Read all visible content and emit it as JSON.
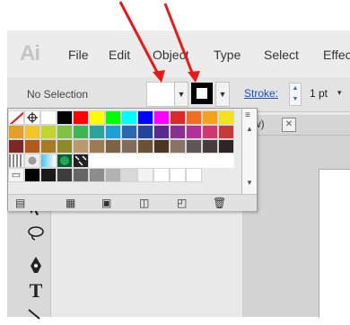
{
  "app": {
    "logo": "Ai",
    "accent": "#e31b1b"
  },
  "menu": {
    "items": [
      "File",
      "Edit",
      "Object",
      "Type",
      "Select",
      "Effect"
    ]
  },
  "control_bar": {
    "selection_label": "No Selection",
    "fill_dropdown_icon": "chevron-down-icon",
    "stroke_dropdown_icon": "chevron-down-icon",
    "stroke_label": "Stroke:",
    "stroke_weight": "1 pt",
    "stroke_weight_dropdown": "▾"
  },
  "document_tab": {
    "label": "w)",
    "close_glyph": "✕"
  },
  "swatch_panel": {
    "rows": [
      [
        "#ffffff",
        "#ffffff",
        "#ffffff",
        "#000000",
        "#ff0000",
        "#ffff00",
        "#00ff00",
        "#00ffff",
        "#0000ff",
        "#ff00ff",
        "#d92b2b",
        "#ef6f24",
        "#f4a31e",
        "#f6e41a"
      ],
      [
        "#e2a126",
        "#f0c42c",
        "#c0d62e",
        "#7dc242",
        "#3fb552",
        "#2aa39a",
        "#1f9dd6",
        "#2a68b2",
        "#23449a",
        "#5a2b8f",
        "#8c2f93",
        "#b3309a",
        "#d1386e",
        "#c33b3b"
      ],
      [
        "#7e2727",
        "#b15a1b",
        "#a67b22",
        "#8e8a2a",
        "#ba9a6c",
        "#9c7b53",
        "#7d6245",
        "#806c5a",
        "#6b5135",
        "#4d3521",
        "#8a7265",
        "#5f5555",
        "#453d3d",
        "#2e2626"
      ],
      [
        "#e8e8e8",
        "#dcdcdc",
        "#cfcfcf",
        "#bdbdbd",
        "#a8a8a8",
        "#939393",
        "#7b7b7b",
        "#636363",
        "#4b4b4b",
        "#333333",
        "#1c1c1c",
        "#000000"
      ],
      [
        "#ffffff",
        "#f2f2f2",
        "#d9d9d9",
        "#b2b2b2",
        "#8c8c8c",
        "#666666",
        "#3d3d3d",
        "#1a1a1a"
      ]
    ],
    "panel_menu_icon": "≡",
    "footer_icons": [
      "swatch-libraries-icon",
      "show-kinds-icon",
      "swatch-options-icon",
      "new-color-group-icon",
      "new-swatch-icon",
      "delete-swatch-icon"
    ]
  },
  "tools": [
    "selection-icon",
    "lasso-icon",
    "pen-icon",
    "type-icon",
    "line-icon"
  ]
}
